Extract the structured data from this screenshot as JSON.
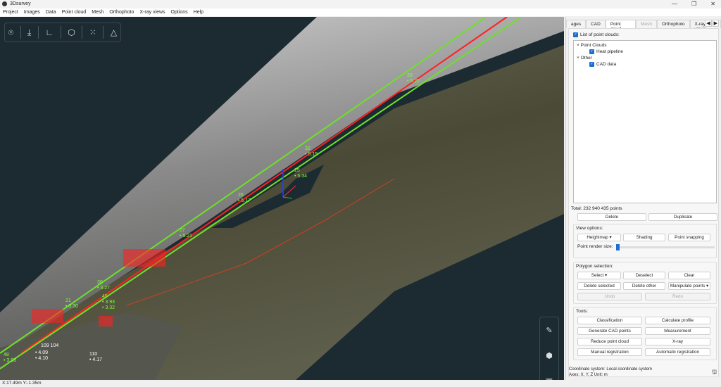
{
  "window": {
    "title": "3Dsurvey",
    "min": "—",
    "max": "❐",
    "close": "✕"
  },
  "menu": [
    "Project",
    "Images",
    "Data",
    "Point cloud",
    "Mesh",
    "Orthophoto",
    "X-ray views",
    "Options",
    "Help"
  ],
  "viewport": {
    "labels_green": [
      [
        "33",
        "• 5.22"
      ],
      [
        "32",
        "• 5.19"
      ],
      [
        "25",
        "• 5.34"
      ],
      [
        "26",
        "• 5.17"
      ],
      [
        "27",
        "• 5.21"
      ],
      [
        "30",
        "• 3.27"
      ],
      [
        "45",
        "• 3.93"
      ],
      [
        "21",
        "• 5.30"
      ],
      [
        "48",
        "• 3.98"
      ]
    ],
    "labels_extra": [
      "• 3.32"
    ],
    "labels_white": [
      [
        "109",
        "104"
      ],
      [
        "• 4.09",
        "• 4.10"
      ],
      [
        "110",
        "• 4.17"
      ]
    ],
    "colors": {
      "green": "#7cff3a",
      "red": "#ff2020",
      "background": "#1c2a31"
    }
  },
  "status": {
    "coords": "X:17.49m Y:-1.35m"
  },
  "panel": {
    "tabs": [
      "ages",
      "CAD",
      "Point cloud",
      "Mesh",
      "Orthophoto",
      "X-ray views"
    ],
    "list_label": "List of point clouds:",
    "tree": {
      "group1": "Point Clouds",
      "item1": "Heat pipeline",
      "group2": "Other",
      "item2": "CAD data"
    },
    "total": "Total: 232 940 435 points",
    "delete": "Delete",
    "duplicate": "Duplicate",
    "view_options": {
      "title": "View options:",
      "heightmap": "Heightmap",
      "shading": "Shading",
      "snapping": "Point snapping",
      "render_size": "Point render size:",
      "render_size_value": 0
    },
    "polygon": {
      "title": "Polygon selection:",
      "select": "Select",
      "deselect": "Deselect",
      "clear": "Clear",
      "delete_selected": "Delete selected",
      "delete_other": "Delete other",
      "manipulate": "Manipulate points",
      "undo": "Undo",
      "redo": "Redo"
    },
    "tools": {
      "title": "Tools:",
      "classification": "Classification",
      "profile": "Calculate profile",
      "cad_points": "Generate CAD points",
      "measurement": "Measurement",
      "reduce": "Reduce point cloud",
      "xray": "X-ray",
      "manual": "Manual registration",
      "automatic": "Automatic registration"
    },
    "coord_system": "Coordinate system: Local coordinate system",
    "axes": "Axes: X, Y, Z Unit: m"
  }
}
